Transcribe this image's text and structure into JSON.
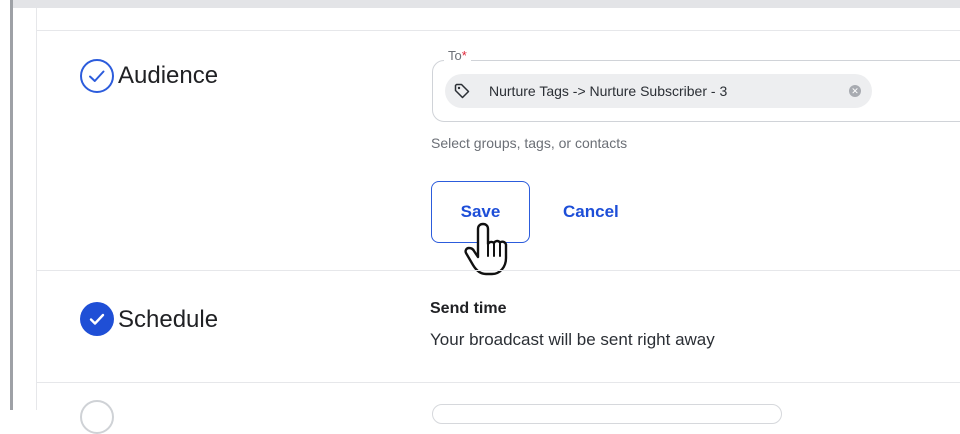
{
  "audience": {
    "title": "Audience",
    "to_label": "To",
    "required_mark": "*",
    "chip_text": "Nurture Tags -> Nurture Subscriber - 3",
    "helper": "Select groups, tags, or contacts",
    "save_label": "Save",
    "cancel_label": "Cancel"
  },
  "schedule": {
    "title": "Schedule",
    "send_time_label": "Send time",
    "send_time_value": "Your broadcast will be sent right away"
  },
  "colors": {
    "accent": "#1f4fd6",
    "link": "#1d4ed8",
    "required": "#e0273a"
  },
  "icons": [
    "check-circle-outline-icon",
    "check-circle-filled-icon",
    "tag-icon",
    "chip-remove-icon",
    "hand-pointer-cursor"
  ]
}
